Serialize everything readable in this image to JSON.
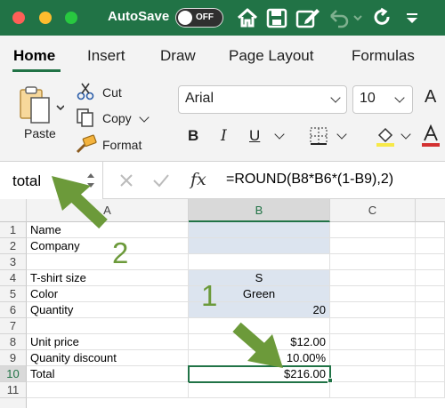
{
  "titlebar": {
    "autosave_label": "AutoSave",
    "autosave_state": "OFF",
    "background_color": "#217346",
    "icons": [
      "home-icon",
      "save-icon",
      "edit-icon",
      "undo-icon",
      "redo-icon",
      "customize-menu-icon"
    ]
  },
  "tabs": [
    {
      "label": "Home",
      "active": true
    },
    {
      "label": "Insert",
      "active": false
    },
    {
      "label": "Draw",
      "active": false
    },
    {
      "label": "Page Layout",
      "active": false
    },
    {
      "label": "Formulas",
      "active": false
    }
  ],
  "clipboard": {
    "paste_label": "Paste",
    "cut_label": "Cut",
    "copy_label": "Copy",
    "format_label": "Format"
  },
  "font": {
    "family": "Arial",
    "size": "10",
    "bold": "B",
    "italic": "I",
    "underline": "U"
  },
  "formula_bar": {
    "name_box": "total",
    "fx_label": "fx",
    "formula": "=ROUND(B8*B6*(1-B9),2)"
  },
  "grid": {
    "columns": [
      "A",
      "B",
      "C"
    ],
    "selected_column": "B",
    "selected_cell": "B10",
    "rows": [
      {
        "num": "1",
        "a": "Name",
        "b": ""
      },
      {
        "num": "2",
        "a": "Company",
        "b": ""
      },
      {
        "num": "3",
        "a": "",
        "b": ""
      },
      {
        "num": "4",
        "a": "T-shirt size",
        "b": "S"
      },
      {
        "num": "5",
        "a": "Color",
        "b": "Green"
      },
      {
        "num": "6",
        "a": "Quantity",
        "b": "20"
      },
      {
        "num": "7",
        "a": "",
        "b": ""
      },
      {
        "num": "8",
        "a": "Unit price",
        "b": "$12.00"
      },
      {
        "num": "9",
        "a": "Quanity discount",
        "b": "10.00%"
      },
      {
        "num": "10",
        "a": "Total",
        "b": "$216.00"
      },
      {
        "num": "11",
        "a": "",
        "b": ""
      }
    ]
  },
  "annotations": {
    "label_1": "1",
    "label_2": "2",
    "arrow_color": "#6c9a3a"
  }
}
